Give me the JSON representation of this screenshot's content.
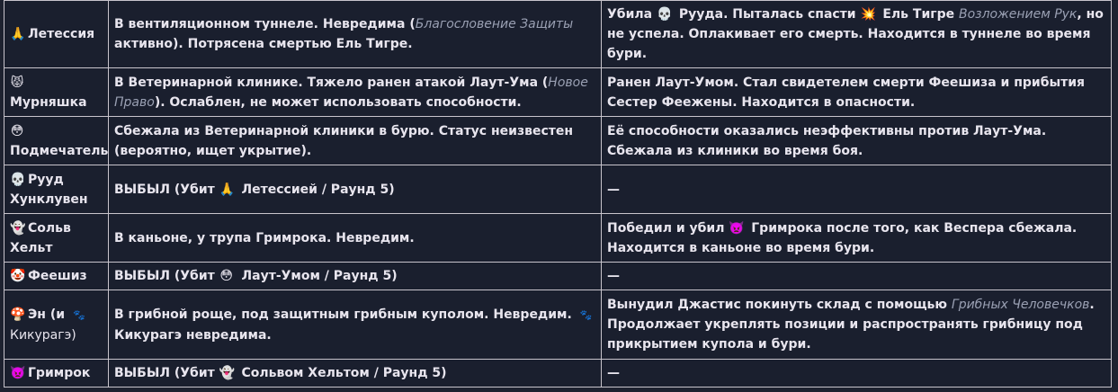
{
  "rows": [
    {
      "name": "Летессия",
      "icon": "🙏",
      "icon_name": "praying-hands-icon",
      "state": {
        "pre": "В вентиляционном туннеле. Невредима (",
        "em": "Благословение Защиты",
        "post": " активно). Потрясена смертью Ель Тигре."
      },
      "events": {
        "a": "Убила ",
        "icon1": "💀",
        "icon1_name": "skull-icon",
        "b": " Рууда. Пыталась спасти ",
        "icon2": "💥",
        "icon2_name": "explosion-icon",
        "c": " Ель Тигре ",
        "em": "Возложением Рук",
        "d": ", но не успела. Оплакивает его смерть. Находится в туннеле во время бури."
      }
    },
    {
      "name": "Мурняшка",
      "icon": "😾",
      "icon_name": "pouting-cat-icon",
      "state": {
        "pre": "В Ветеринарной клинике. Тяжело ранен атакой Лаут-Ума (",
        "em": "Новое Право",
        "post": "). Ослаблен, не может использовать способности."
      },
      "events": "Ранен Лаут-Умом. Стал свидетелем смерти Феешиза и прибытия Сестер Феежены. Находится в опасности."
    },
    {
      "name": "Подмечатель",
      "icon": "😳",
      "icon_name": "flushed-face-icon",
      "state": "Сбежала из Ветеринарной клиники в бурю. Статус неизвестен (вероятно, ищет укрытие).",
      "events": "Её способности оказались неэффективны против Лаут-Ума. Сбежала из клиники во время боя."
    },
    {
      "name": "Рууд Хунклувен",
      "icon": "💀",
      "icon_name": "skull-icon",
      "state": {
        "out": "ВЫБЫЛ",
        "pre": " (Убит ",
        "icon": "🙏",
        "icon_name": "praying-hands-icon",
        "post": " Летессией / Раунд 5)"
      },
      "events": "—"
    },
    {
      "name": "Сольв Хельт",
      "icon": "👻",
      "icon_name": "ghost-icon",
      "state": "В каньоне, у трупа Гримрока. Невредим.",
      "events": {
        "a": "Победил и убил ",
        "icon1": "👿",
        "icon1_name": "imp-icon",
        "b": " Гримрока после того, как Веспера сбежала. Находится в каньоне во время бури."
      }
    },
    {
      "name": "Феешиз",
      "icon": "🤡",
      "icon_name": "clown-icon",
      "state": {
        "out": "ВЫБЫЛ",
        "pre": " (Убит ",
        "icon": "😳",
        "icon_name": "flushed-face-icon",
        "post": " Лаут-Умом / Раунд 5)"
      },
      "events": "—"
    },
    {
      "name": "Эн (и ",
      "name_tail": "Кикурагэ)",
      "icon": "🍄",
      "icon_name": "mushroom-icon",
      "icon_small": "🐾",
      "icon_small_name": "paw-prints-icon",
      "state": {
        "pre": "В грибной роще, под защитным грибным куполом. Невредим. ",
        "icon": "🐾",
        "icon_name": "paw-prints-icon",
        "post": " Кикурагэ невредима."
      },
      "events": {
        "a": "Вынудил Джастис покинуть склад с помощью ",
        "em": "Грибных Человечков",
        "b": ". Продолжает укреплять позиции и распространять грибницу под прикрытием купола и бури."
      }
    },
    {
      "name": "Гримрок",
      "icon": "👿",
      "icon_name": "imp-icon",
      "state": {
        "out": "ВЫБЫЛ",
        "pre": " (Убит ",
        "icon": "👻",
        "icon_name": "ghost-icon",
        "post": " Сольвом Хельтом / Раунд 5)"
      },
      "events": "—"
    }
  ]
}
